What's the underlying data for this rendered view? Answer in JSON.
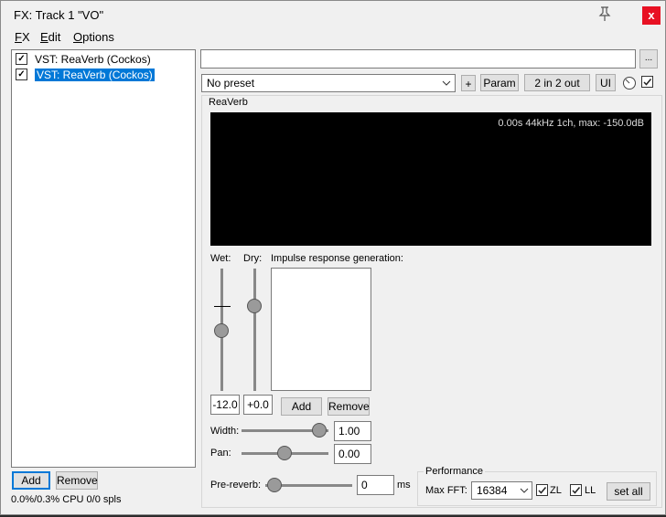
{
  "window": {
    "title": "FX: Track 1 \"VO\"",
    "close_label": "x"
  },
  "menu": [
    {
      "key": "F",
      "rest": "X"
    },
    {
      "key": "E",
      "rest": "dit"
    },
    {
      "key": "O",
      "rest": "ptions"
    }
  ],
  "fx_list": [
    {
      "label": "VST: ReaVerb (Cockos)",
      "checked": true,
      "selected": false
    },
    {
      "label": "VST: ReaVerb (Cockos)",
      "checked": true,
      "selected": true
    }
  ],
  "left_buttons": {
    "add": "Add",
    "remove": "Remove"
  },
  "status": "0.0%/0.3% CPU 0/0 spls",
  "plugin": {
    "browse_label": "...",
    "preset": "No preset",
    "plus_label": "+",
    "param_label": "Param",
    "io_label": "2 in 2 out",
    "ui_label": "UI",
    "name": "ReaVerb",
    "display_text": "0.00s 44kHz 1ch, max: -150.0dB"
  },
  "reaverb": {
    "wet_label": "Wet:",
    "dry_label": "Dry:",
    "ir_label": "Impulse response generation:",
    "wet_value": "-12.0",
    "dry_value": "+0.0",
    "add_label": "Add",
    "remove_label": "Remove",
    "width_label": "Width:",
    "width_value": "1.00",
    "pan_label": "Pan:",
    "pan_value": "0.00",
    "prereverb_label": "Pre-reverb:",
    "prereverb_value": "0",
    "prereverb_unit": "ms"
  },
  "performance": {
    "label": "Performance",
    "max_fft_label": "Max FFT:",
    "max_fft_value": "16384",
    "zl_label": "ZL",
    "ll_label": "LL",
    "zl_checked": true,
    "ll_checked": true,
    "set_all_label": "set all"
  }
}
